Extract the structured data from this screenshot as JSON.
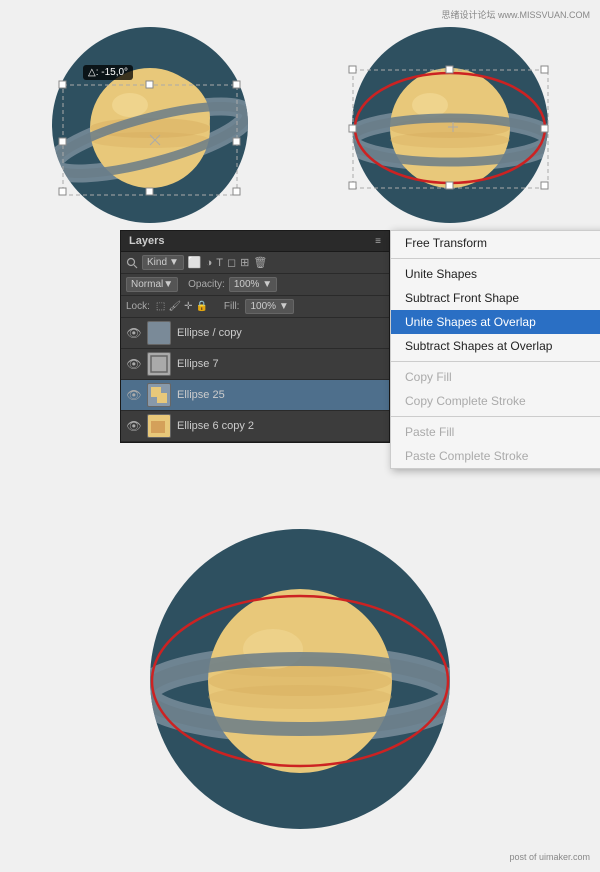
{
  "watermark_top": "思绪设计论坛  www.MISSVUAN.COM",
  "watermark_bottom": "post of uimaker.com",
  "layers_panel": {
    "title": "Layers",
    "kind_label": "Kind",
    "normal_label": "Normal",
    "opacity_label": "Opacity:",
    "opacity_value": "100%",
    "lock_label": "Lock:",
    "fill_label": "Fill:",
    "fill_value": "100%",
    "items": [
      {
        "name": "Ellipse / copy",
        "visible": true,
        "selected": false
      },
      {
        "name": "Ellipse 7",
        "visible": true,
        "selected": false
      },
      {
        "name": "Ellipse 25",
        "visible": true,
        "selected": true
      },
      {
        "name": "Ellipse 6 copy 2",
        "visible": true,
        "selected": false
      }
    ]
  },
  "context_menu": {
    "items": [
      {
        "label": "Free Transform",
        "disabled": false,
        "active": false,
        "separator_after": true
      },
      {
        "label": "Unite Shapes",
        "disabled": false,
        "active": false,
        "separator_after": false
      },
      {
        "label": "Subtract Front Shape",
        "disabled": false,
        "active": false,
        "separator_after": false
      },
      {
        "label": "Unite Shapes at Overlap",
        "disabled": false,
        "active": true,
        "separator_after": false
      },
      {
        "label": "Subtract Shapes at Overlap",
        "disabled": false,
        "active": false,
        "separator_after": true
      },
      {
        "label": "Copy Fill",
        "disabled": true,
        "active": false,
        "separator_after": false
      },
      {
        "label": "Copy Complete Stroke",
        "disabled": true,
        "active": false,
        "separator_after": true
      },
      {
        "label": "Paste Fill",
        "disabled": true,
        "active": false,
        "separator_after": false
      },
      {
        "label": "Paste Complete Stroke",
        "disabled": true,
        "active": false,
        "separator_after": false
      }
    ]
  },
  "angle_label": "△: -15,0°"
}
